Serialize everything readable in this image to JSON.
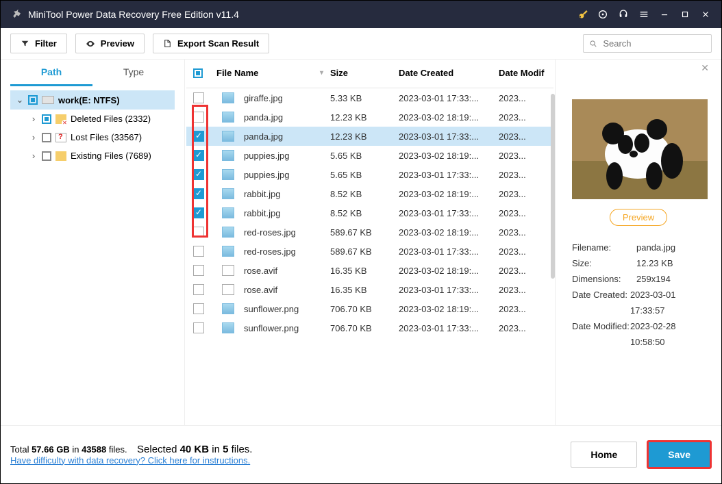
{
  "titlebar": {
    "title": "MiniTool Power Data Recovery Free Edition v11.4"
  },
  "toolbar": {
    "filter": "Filter",
    "preview": "Preview",
    "export": "Export Scan Result",
    "search_placeholder": "Search"
  },
  "sidebar": {
    "tabs": {
      "path": "Path",
      "type": "Type"
    },
    "root": "work(E: NTFS)",
    "items": [
      {
        "label": "Deleted Files (2332)"
      },
      {
        "label": "Lost Files (33567)"
      },
      {
        "label": "Existing Files (7689)"
      }
    ]
  },
  "table": {
    "headers": {
      "name": "File Name",
      "size": "Size",
      "created": "Date Created",
      "modified": "Date Modif"
    },
    "rows": [
      {
        "name": "giraffe.jpg",
        "size": "5.33 KB",
        "created": "2023-03-01 17:33:...",
        "mod": "2023...",
        "checked": false,
        "picture": true,
        "selected": false
      },
      {
        "name": "panda.jpg",
        "size": "12.23 KB",
        "created": "2023-03-02 18:19:...",
        "mod": "2023...",
        "checked": false,
        "picture": true,
        "selected": false
      },
      {
        "name": "panda.jpg",
        "size": "12.23 KB",
        "created": "2023-03-01 17:33:...",
        "mod": "2023...",
        "checked": true,
        "picture": true,
        "selected": true
      },
      {
        "name": "puppies.jpg",
        "size": "5.65 KB",
        "created": "2023-03-02 18:19:...",
        "mod": "2023...",
        "checked": true,
        "picture": true,
        "selected": false
      },
      {
        "name": "puppies.jpg",
        "size": "5.65 KB",
        "created": "2023-03-01 17:33:...",
        "mod": "2023...",
        "checked": true,
        "picture": true,
        "selected": false
      },
      {
        "name": "rabbit.jpg",
        "size": "8.52 KB",
        "created": "2023-03-02 18:19:...",
        "mod": "2023...",
        "checked": true,
        "picture": true,
        "selected": false
      },
      {
        "name": "rabbit.jpg",
        "size": "8.52 KB",
        "created": "2023-03-01 17:33:...",
        "mod": "2023...",
        "checked": true,
        "picture": true,
        "selected": false
      },
      {
        "name": "red-roses.jpg",
        "size": "589.67 KB",
        "created": "2023-03-02 18:19:...",
        "mod": "2023...",
        "checked": false,
        "picture": true,
        "selected": false
      },
      {
        "name": "red-roses.jpg",
        "size": "589.67 KB",
        "created": "2023-03-01 17:33:...",
        "mod": "2023...",
        "checked": false,
        "picture": true,
        "selected": false
      },
      {
        "name": "rose.avif",
        "size": "16.35 KB",
        "created": "2023-03-02 18:19:...",
        "mod": "2023...",
        "checked": false,
        "picture": false,
        "selected": false
      },
      {
        "name": "rose.avif",
        "size": "16.35 KB",
        "created": "2023-03-01 17:33:...",
        "mod": "2023...",
        "checked": false,
        "picture": false,
        "selected": false
      },
      {
        "name": "sunflower.png",
        "size": "706.70 KB",
        "created": "2023-03-02 18:19:...",
        "mod": "2023...",
        "checked": false,
        "picture": true,
        "selected": false
      },
      {
        "name": "sunflower.png",
        "size": "706.70 KB",
        "created": "2023-03-01 17:33:...",
        "mod": "2023...",
        "checked": false,
        "picture": true,
        "selected": false
      }
    ]
  },
  "preview": {
    "button": "Preview",
    "rows": {
      "fn_l": "Filename:",
      "fn_v": "panda.jpg",
      "sz_l": "Size:",
      "sz_v": "12.23 KB",
      "dm_l": "Dimensions:",
      "dm_v": "259x194",
      "dc_l": "Date Created:",
      "dc_v": "2023-03-01 17:33:57",
      "md_l": "Date Modified:",
      "md_v": "2023-02-28 10:58:50"
    }
  },
  "footer": {
    "total_prefix": "Total ",
    "total_size": "57.66 GB",
    "in": " in ",
    "total_files": "43588",
    "files": " files.",
    "sel_prefix": "Selected ",
    "sel_size": "40 KB",
    "in2": " in ",
    "sel_count": "5",
    "files2": " files.",
    "help": "Have difficulty with data recovery? Click here for instructions.",
    "home": "Home",
    "save": "Save"
  }
}
